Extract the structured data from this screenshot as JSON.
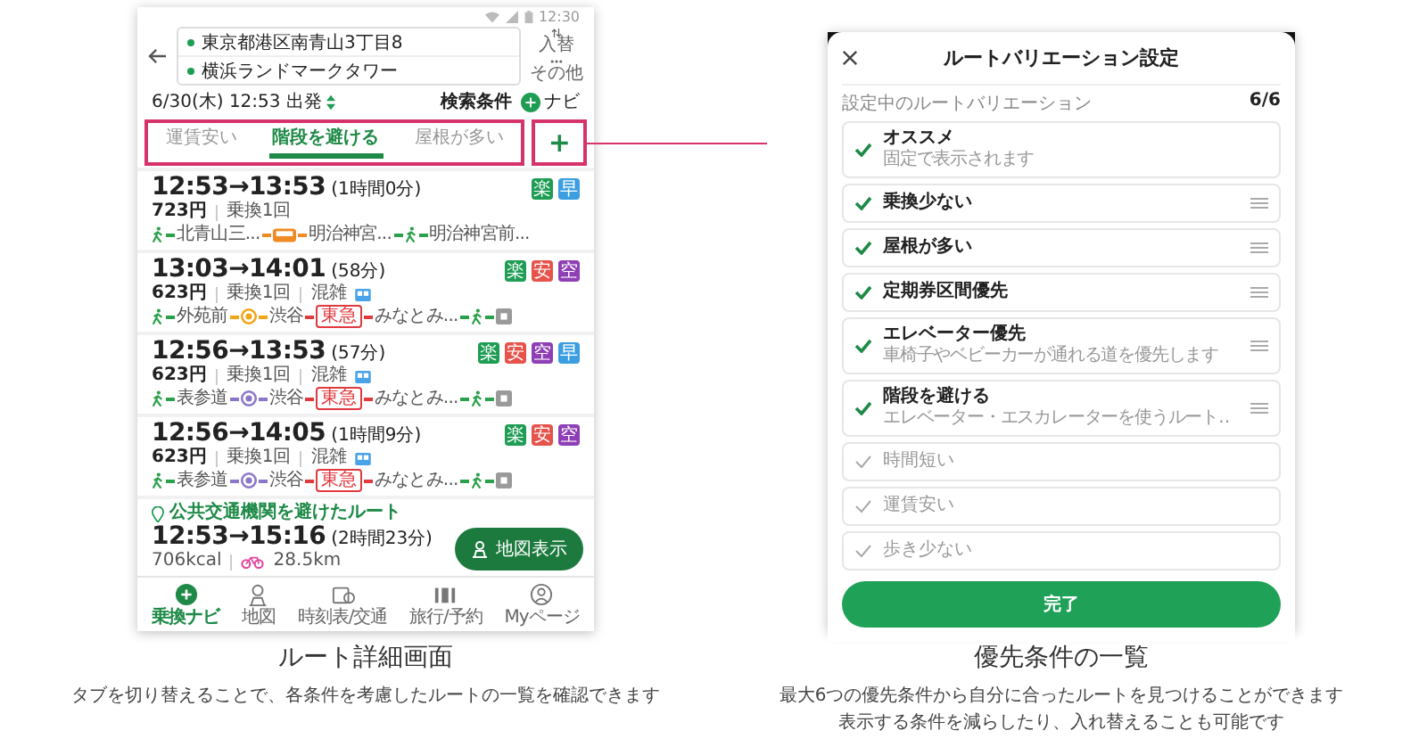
{
  "left_screen": {
    "status_bar": {
      "time": "12:30"
    },
    "route_inputs": {
      "from": "東京都港区南青山3丁目8",
      "to": "横浜ランドマークタワー",
      "swap_label": "入替",
      "more_label": "その他"
    },
    "search_bar": {
      "departure": "6/30(木) 12:53 出発",
      "conditions_label": "検索条件",
      "navi_label": "ナビ"
    },
    "tabs": [
      {
        "label": "運賃安い",
        "selected": false
      },
      {
        "label": "階段を避ける",
        "selected": true
      },
      {
        "label": "屋根が多い",
        "selected": false
      }
    ],
    "add_tab_button": "+",
    "routes": [
      {
        "kind": "transit",
        "time": "12:53→13:53",
        "duration": "(1時間0分)",
        "fare": "723円",
        "transfers": "乗換1回",
        "badges": [
          {
            "text": "楽",
            "color": "#1f9d55"
          },
          {
            "text": "早",
            "color": "#3a9ee0"
          }
        ],
        "segments": [
          {
            "kind": "walk"
          },
          {
            "kind": "stop",
            "text": "北青山三..."
          },
          {
            "kind": "bus"
          },
          {
            "kind": "stop",
            "text": "明治神宮..."
          },
          {
            "kind": "walk"
          },
          {
            "kind": "stop",
            "text": "明治神宮前..."
          }
        ]
      },
      {
        "kind": "transit",
        "time": "13:03→14:01",
        "duration": "(58分)",
        "fare": "623円",
        "transfers": "乗換1回",
        "congestion": "混雑",
        "badges": [
          {
            "text": "楽",
            "color": "#1f9d55"
          },
          {
            "text": "安",
            "color": "#e5534b"
          },
          {
            "text": "空",
            "color": "#8e3fb5"
          }
        ],
        "segments": [
          {
            "kind": "walk"
          },
          {
            "kind": "stop",
            "text": "外苑前"
          },
          {
            "kind": "subway",
            "color": "#f2a516"
          },
          {
            "kind": "stop",
            "text": "渋谷"
          },
          {
            "kind": "rail",
            "text": "東急"
          },
          {
            "kind": "stop",
            "text": "みなとみ..."
          },
          {
            "kind": "walk"
          },
          {
            "kind": "goal"
          }
        ]
      },
      {
        "kind": "transit",
        "time": "12:56→13:53",
        "duration": "(57分)",
        "fare": "623円",
        "transfers": "乗換1回",
        "congestion": "混雑",
        "badges": [
          {
            "text": "楽",
            "color": "#1f9d55"
          },
          {
            "text": "安",
            "color": "#e5534b"
          },
          {
            "text": "空",
            "color": "#8e3fb5"
          },
          {
            "text": "早",
            "color": "#3a9ee0"
          }
        ],
        "segments": [
          {
            "kind": "walk"
          },
          {
            "kind": "stop",
            "text": "表参道"
          },
          {
            "kind": "subway",
            "color": "#8b76c9"
          },
          {
            "kind": "stop",
            "text": "渋谷"
          },
          {
            "kind": "rail",
            "text": "東急"
          },
          {
            "kind": "stop",
            "text": "みなとみ..."
          },
          {
            "kind": "walk"
          },
          {
            "kind": "goal"
          }
        ]
      },
      {
        "kind": "transit",
        "time": "12:56→14:05",
        "duration": "(1時間9分)",
        "fare": "623円",
        "transfers": "乗換1回",
        "congestion": "混雑",
        "badges": [
          {
            "text": "楽",
            "color": "#1f9d55"
          },
          {
            "text": "安",
            "color": "#e5534b"
          },
          {
            "text": "空",
            "color": "#8e3fb5"
          }
        ],
        "segments": [
          {
            "kind": "walk"
          },
          {
            "kind": "stop",
            "text": "表参道"
          },
          {
            "kind": "subway",
            "color": "#8b76c9"
          },
          {
            "kind": "stop",
            "text": "渋谷"
          },
          {
            "kind": "rail",
            "text": "東急"
          },
          {
            "kind": "stop",
            "text": "みなとみ..."
          },
          {
            "kind": "walk"
          },
          {
            "kind": "goal"
          }
        ]
      },
      {
        "kind": "bike",
        "note": "公共交通機関を避けたルート",
        "time": "12:53→15:16",
        "duration": "(2時間23分)",
        "calories": "706kcal",
        "distance": "28.5km"
      }
    ],
    "map_button": "地図表示",
    "bottom_nav": [
      {
        "kind": "navi",
        "label": "乗換ナビ",
        "selected": true
      },
      {
        "kind": "map",
        "label": "地図",
        "selected": false
      },
      {
        "kind": "timetable",
        "label": "時刻表/交通",
        "selected": false
      },
      {
        "kind": "travel",
        "label": "旅行/予約",
        "selected": false
      },
      {
        "kind": "mypage",
        "label": "Myページ",
        "selected": false
      }
    ]
  },
  "right_screen": {
    "title": "ルートバリエーション設定",
    "section_label": "設定中のルートバリエーション",
    "count": "6/6",
    "variations": [
      {
        "label": "オススメ",
        "description": "固定で表示されます",
        "checked": true,
        "draggable": false
      },
      {
        "label": "乗換少ない",
        "checked": true,
        "draggable": true
      },
      {
        "label": "屋根が多い",
        "checked": true,
        "draggable": true
      },
      {
        "label": "定期券区間優先",
        "checked": true,
        "draggable": true
      },
      {
        "label": "エレベーター優先",
        "description": "車椅子やベビーカーが通れる道を優先します",
        "checked": true,
        "draggable": true
      },
      {
        "label": "階段を避ける",
        "description": "エレベーター・エスカレーターを使うルート‥",
        "checked": true,
        "draggable": true
      },
      {
        "label": "時間短い",
        "checked": false,
        "draggable": false
      },
      {
        "label": "運賃安い",
        "checked": false,
        "draggable": false
      },
      {
        "label": "歩き少ない",
        "checked": false,
        "draggable": false
      }
    ],
    "done_button": "完了"
  },
  "captions": [
    {
      "title": "ルート詳細画面",
      "lines": [
        "タブを切り替えることで、各条件を考慮したルートの一覧を確認できます"
      ]
    },
    {
      "title": "優先条件の一覧",
      "lines": [
        "最大6つの優先条件から自分に合ったルートを見つけることができます",
        "表示する条件を減らしたり、入れ替えることも可能です"
      ]
    }
  ]
}
